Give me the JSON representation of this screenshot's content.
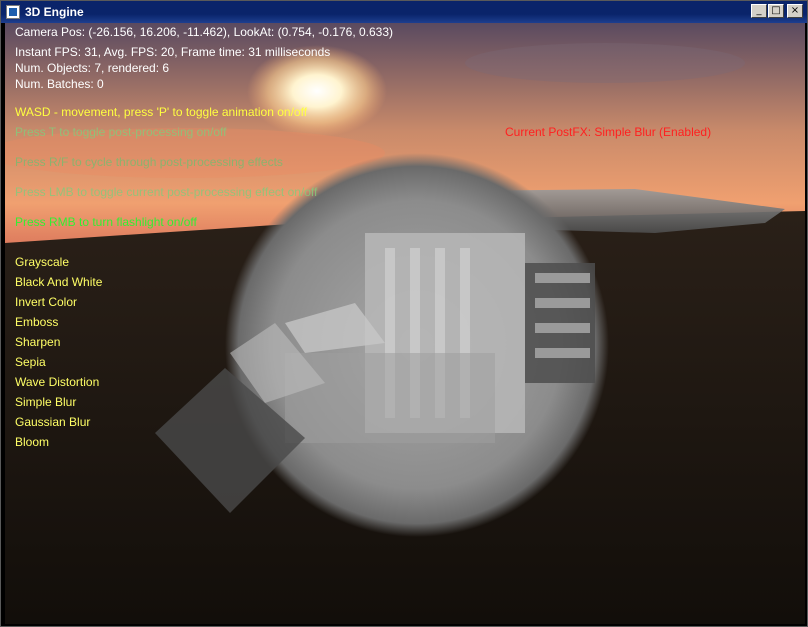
{
  "window": {
    "title": "3D Engine",
    "buttons": {
      "minimize": "_",
      "maximize": "□",
      "close": "×"
    }
  },
  "hud": {
    "camera": "Camera Pos: (-26.156, 16.206, -11.462), LookAt: (0.754, -0.176, 0.633)",
    "fps": "Instant FPS: 31, Avg. FPS: 20, Frame time: 31 milliseconds",
    "objects": "Num. Objects: 7, rendered: 6",
    "batches": "Num. Batches: 0",
    "help": [
      "WASD - movement, press 'P' to toggle animation on/off",
      "Press T to toggle post-processing on/off",
      "Press R/F to cycle through post-processing effects",
      "Press LMB to toggle current post-processing effect on/off",
      "Press RMB to turn flashlight on/off"
    ],
    "current_postfx": "Current PostFX: Simple Blur (Enabled)",
    "effects": [
      "Grayscale",
      "Black And White",
      "Invert Color",
      "Emboss",
      "Sharpen",
      "Sepia",
      "Wave Distortion",
      "Simple Blur",
      "Gaussian Blur",
      "Bloom"
    ]
  }
}
